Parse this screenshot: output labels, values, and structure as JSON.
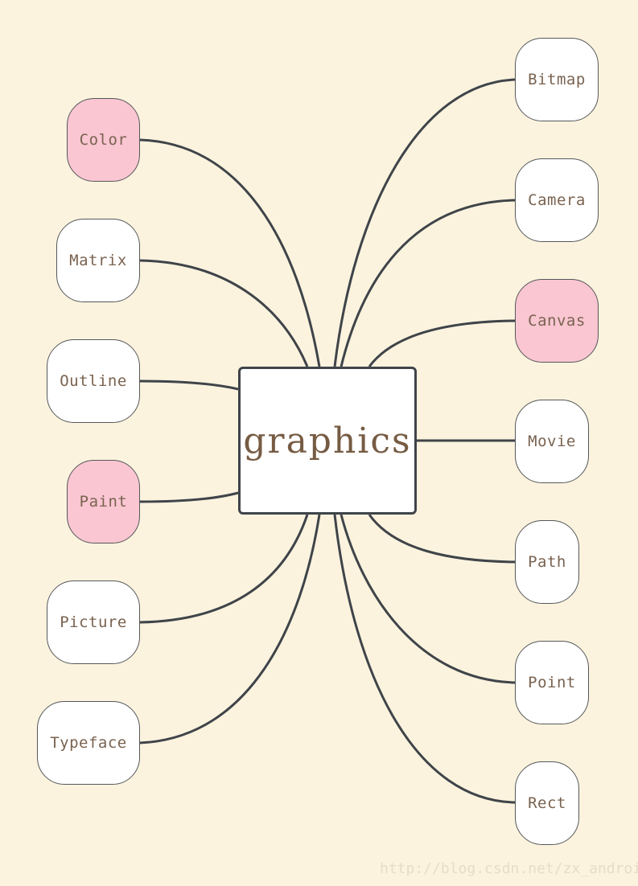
{
  "center": {
    "label": "graphics"
  },
  "left_nodes": [
    {
      "label": "Color",
      "highlight": true
    },
    {
      "label": "Matrix",
      "highlight": false
    },
    {
      "label": "Outline",
      "highlight": false
    },
    {
      "label": "Paint",
      "highlight": true
    },
    {
      "label": "Picture",
      "highlight": false
    },
    {
      "label": "Typeface",
      "highlight": false
    }
  ],
  "right_nodes": [
    {
      "label": "Bitmap",
      "highlight": false
    },
    {
      "label": "Camera",
      "highlight": false
    },
    {
      "label": "Canvas",
      "highlight": true
    },
    {
      "label": "Movie",
      "highlight": false
    },
    {
      "label": "Path",
      "highlight": false
    },
    {
      "label": "Point",
      "highlight": false
    },
    {
      "label": "Rect",
      "highlight": false
    }
  ],
  "watermark": "http://blog.csdn.net/zx_android",
  "colors": {
    "highlight": "#f9c6d2",
    "node": "#ffffff",
    "background": "#fbf3de",
    "line": "#3f4449",
    "text": "#7a6350"
  }
}
